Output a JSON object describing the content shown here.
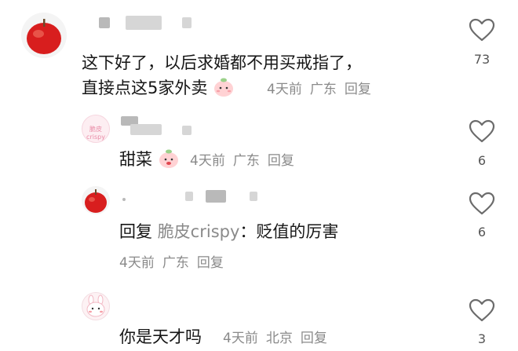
{
  "comments": [
    {
      "line1": "这下好了，以后求婚都不用买戒指了，",
      "line2": "直接点这5家外卖",
      "time": "4天前",
      "location": "广东",
      "reply_label": "回复",
      "likes": "73"
    },
    {
      "avatar_text": "脆皮crispy",
      "text": "甜菜",
      "time": "4天前",
      "location": "广东",
      "reply_label": "回复",
      "likes": "6"
    },
    {
      "text_prefix": "回复",
      "mention": "脆皮crispy",
      "text_suffix": "：贬值的厉害",
      "time": "4天前",
      "location": "广东",
      "reply_label": "回复",
      "likes": "6"
    },
    {
      "text": "你是天才吗",
      "time": "4天前",
      "location": "北京",
      "reply_label": "回复",
      "likes": "3"
    }
  ],
  "icons": {
    "like": "heart-outline-icon"
  }
}
